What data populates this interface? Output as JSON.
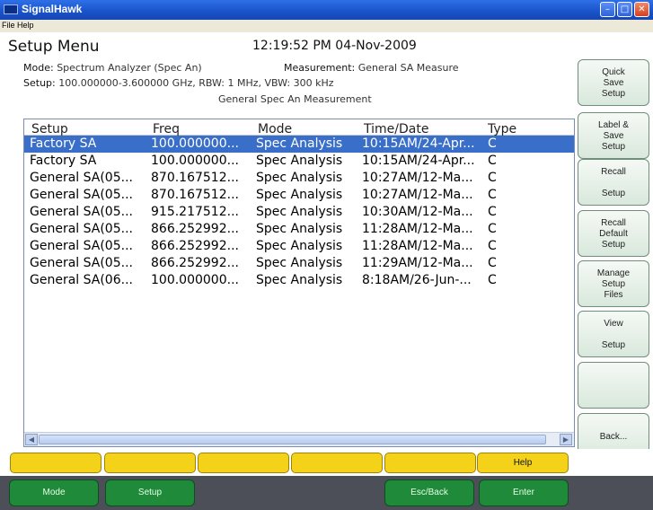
{
  "window": {
    "title": "SignalHawk",
    "minimize_icon": "minimize-icon",
    "maximize_icon": "maximize-icon",
    "close_icon": "close-icon"
  },
  "menu": {
    "file": "File",
    "help": "Help"
  },
  "header": {
    "title": "Setup Menu",
    "datetime": "12:19:52 PM 04-Nov-2009"
  },
  "info": {
    "mode_label": "Mode:",
    "mode_value": "Spectrum Analyzer (Spec An)",
    "measurement_label": "Measurement:",
    "measurement_value": "General SA Measure",
    "setup_label": "Setup:",
    "setup_value": "100.000000-3.600000 GHz, RBW: 1 MHz, VBW: 300 kHz",
    "description": "General Spec An Measurement"
  },
  "table": {
    "columns": [
      "Setup",
      "Freq",
      "Mode",
      "Time/Date",
      "Type"
    ],
    "rows": [
      [
        "Factory SA",
        "100.000000...",
        "Spec Analysis",
        "10:15AM/24-Apr...",
        "C"
      ],
      [
        "Factory SA",
        "100.000000...",
        "Spec Analysis",
        "10:15AM/24-Apr...",
        "C"
      ],
      [
        "General SA(05...",
        "870.167512...",
        "Spec Analysis",
        "10:27AM/12-Ma...",
        "C"
      ],
      [
        "General SA(05...",
        "870.167512...",
        "Spec Analysis",
        "10:27AM/12-Ma...",
        "C"
      ],
      [
        "General SA(05...",
        "915.217512...",
        "Spec Analysis",
        "10:30AM/12-Ma...",
        "C"
      ],
      [
        "General SA(05...",
        "866.252992...",
        "Spec Analysis",
        "11:28AM/12-Ma...",
        "C"
      ],
      [
        "General SA(05...",
        "866.252992...",
        "Spec Analysis",
        "11:28AM/12-Ma...",
        "C"
      ],
      [
        "General SA(05...",
        "866.252992...",
        "Spec Analysis",
        "11:29AM/12-Ma...",
        "C"
      ],
      [
        "General SA(06...",
        "100.000000...",
        "Spec Analysis",
        "8:18AM/26-Jun-...",
        "C"
      ]
    ],
    "selected_row": 0
  },
  "side_buttons": [
    {
      "lines": [
        "Quick",
        "Save",
        "Setup"
      ]
    },
    {
      "lines": [
        "Label &",
        "Save",
        "Setup"
      ]
    },
    {
      "lines": [
        "Recall",
        "",
        "Setup"
      ]
    },
    {
      "lines": [
        "Recall",
        "Default",
        "Setup"
      ]
    },
    {
      "lines": [
        "Manage",
        "Setup",
        "Files"
      ]
    },
    {
      "lines": [
        "View",
        "",
        "Setup"
      ]
    },
    {
      "lines": [
        "",
        "",
        ""
      ]
    },
    {
      "lines": [
        "Back..."
      ]
    }
  ],
  "function_keys": [
    "",
    "",
    "",
    "",
    "",
    "Help"
  ],
  "bottom_keys": {
    "mode": "Mode",
    "setup": "Setup",
    "esc_back": "Esc/Back",
    "enter": "Enter"
  },
  "colors": {
    "titlebar": "#1a52c8",
    "selection": "#3a6fc9",
    "yellow_key": "#f5d21a",
    "green_key": "#1f8a3a"
  }
}
